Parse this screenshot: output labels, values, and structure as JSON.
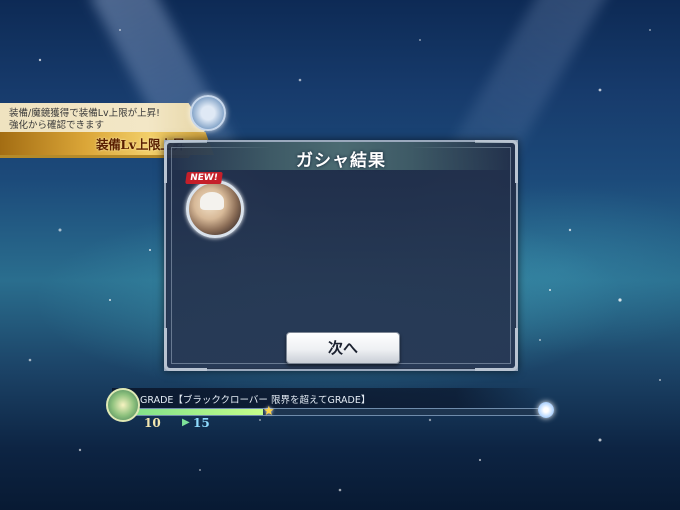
{
  "notification": {
    "message": "装備/魔鏡獲得で装備Lv上限が上昇!\n強化から確認できます",
    "headline": "装備Lv上限上昇",
    "icon": "gear-emblem-icon"
  },
  "result_panel": {
    "title": "ガシャ結果",
    "items": [
      {
        "badge": "NEW!",
        "icon": "character-portrait-icon"
      }
    ],
    "next_button_label": "次へ"
  },
  "grade": {
    "title": "GRADE【ブラッククローバー 限界を超えてGRADE】",
    "from_level": "10",
    "to_level": "15",
    "progress": 0.32,
    "icons": [
      "grade-emblem-icon",
      "star-icon",
      "reward-orb-icon"
    ]
  },
  "colors": {
    "panel_bg": "#223150",
    "badge_red": "#c51f2a",
    "banner_gold": "#dba638",
    "progress_green": "#7fe08a"
  }
}
